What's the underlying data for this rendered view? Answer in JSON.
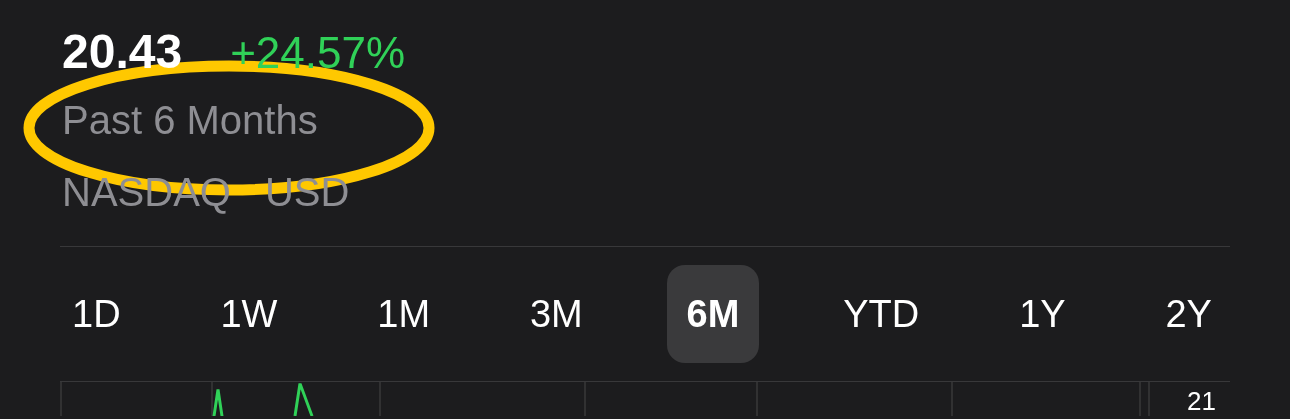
{
  "quote": {
    "price": "20.43",
    "change": "+24.57%",
    "period": "Past 6 Months",
    "exchange": "NASDAQ",
    "currency": "USD"
  },
  "ranges": [
    {
      "label": "1D",
      "selected": false
    },
    {
      "label": "1W",
      "selected": false
    },
    {
      "label": "1M",
      "selected": false
    },
    {
      "label": "3M",
      "selected": false
    },
    {
      "label": "6M",
      "selected": true
    },
    {
      "label": "YTD",
      "selected": false
    },
    {
      "label": "1Y",
      "selected": false
    },
    {
      "label": "2Y",
      "selected": false
    }
  ],
  "chart": {
    "axis_label": "21"
  }
}
